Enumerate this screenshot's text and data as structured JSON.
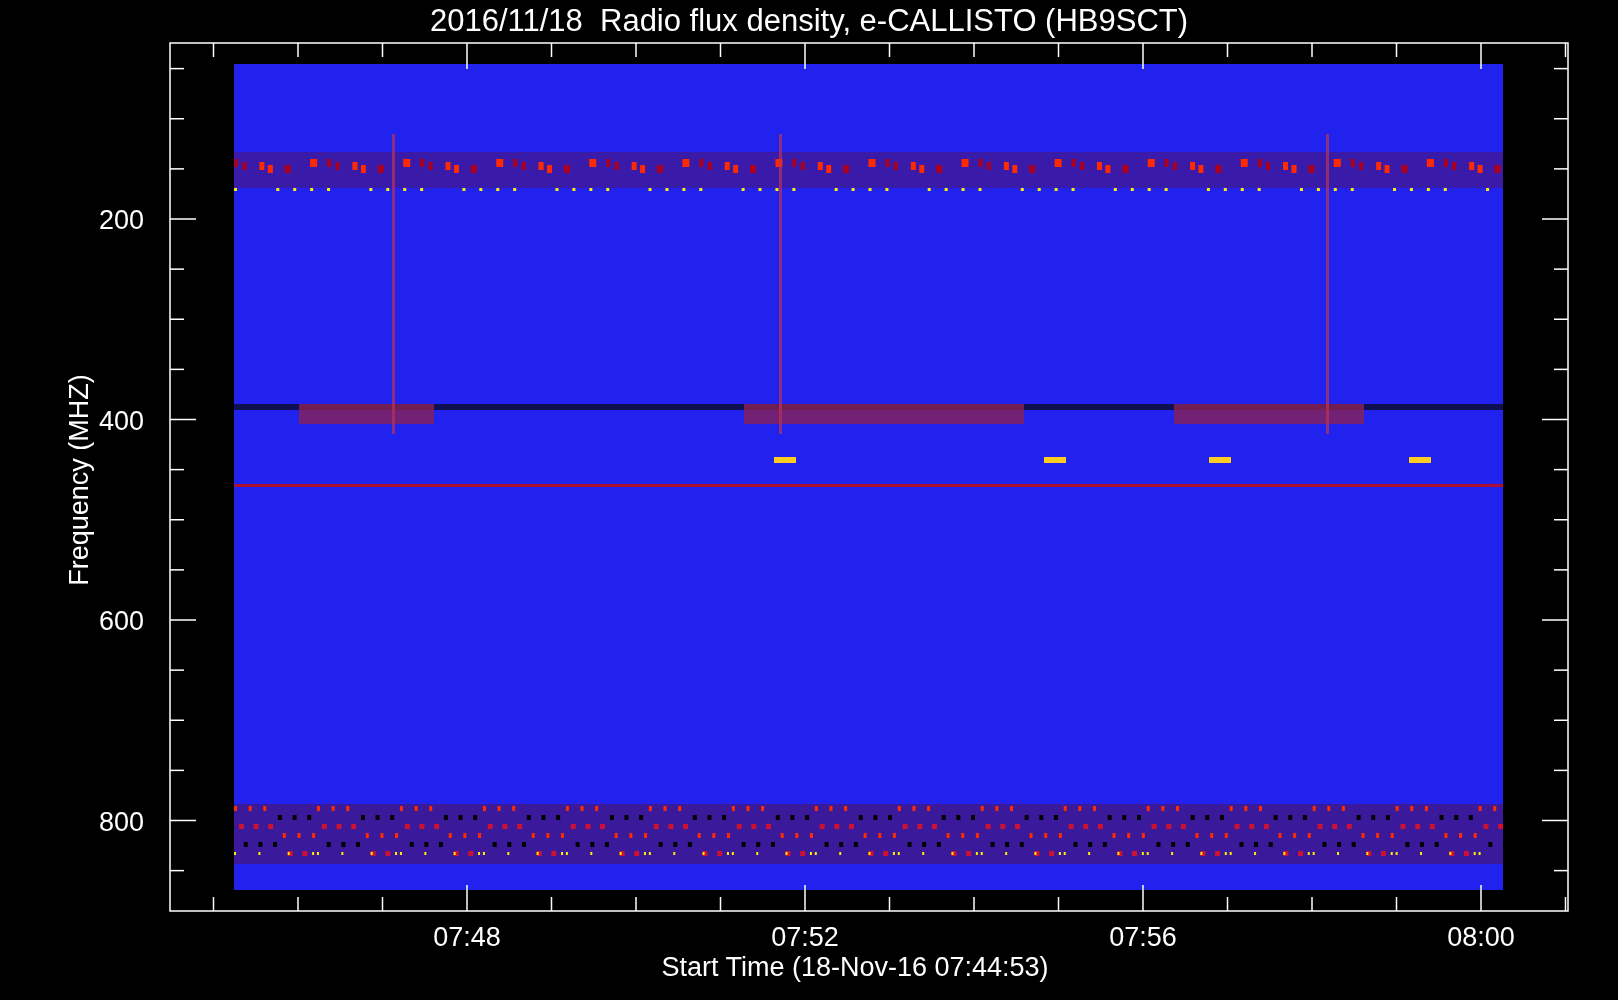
{
  "title": "2016/11/18  Radio flux density, e-CALLISTO (HB9SCT)",
  "plot": {
    "ylabel": "Frequency (MHZ)",
    "xlabel": "Start Time (18-Nov-16 07:44:53)",
    "yticks": [
      "200",
      "400",
      "600",
      "800"
    ],
    "xticks": [
      "07:48",
      "07:52",
      "07:56",
      "08:00"
    ]
  }
}
